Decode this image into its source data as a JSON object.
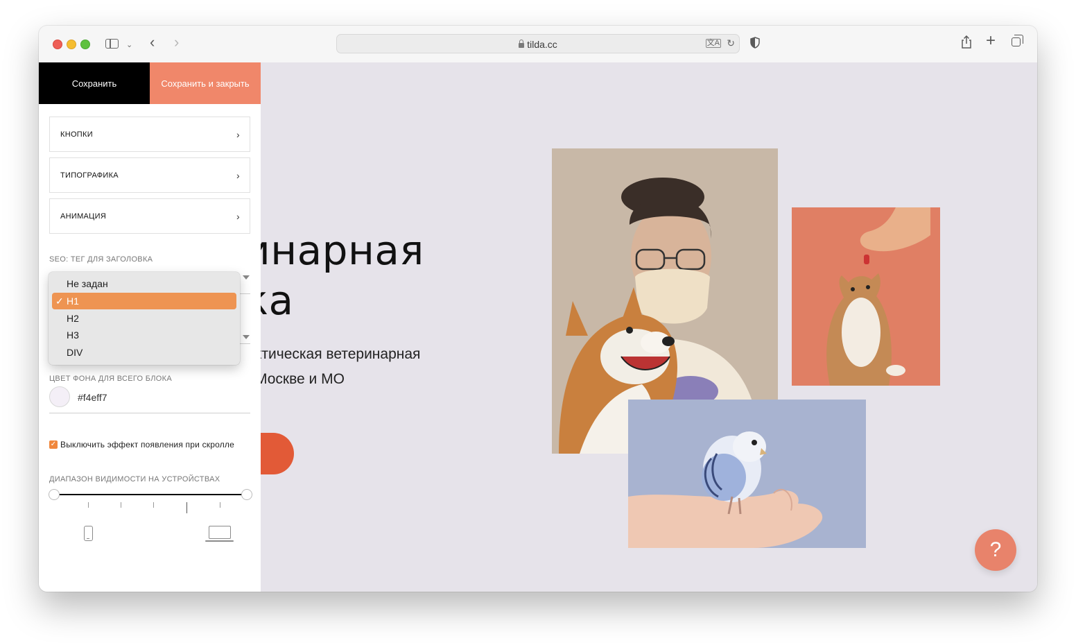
{
  "browser": {
    "url": "tilda.cc"
  },
  "editor": {
    "save_label": "Сохранить",
    "save_close_label": "Сохранить и закрыть",
    "sections": [
      {
        "label": "КНОПКИ"
      },
      {
        "label": "ТИПОГРАФИКА"
      },
      {
        "label": "АНИМАЦИЯ"
      }
    ],
    "seo_label": "SEO: ТЕГ ДЛЯ ЗАГОЛОВКА",
    "seo_options": [
      "Не задан",
      "H1",
      "H2",
      "H3",
      "DIV"
    ],
    "seo_selected": "H1",
    "bg_color_label": "ЦВЕТ ФОНА ДЛЯ ВСЕГО БЛОКА",
    "bg_color_value": "#f4eff7",
    "disable_scroll_label": "Выключить эффект появления при скролле",
    "disable_scroll_checked": true,
    "visibility_label": "ДИАПАЗОН ВИДИМОСТИ НА УСТРОЙСТВАХ"
  },
  "preview": {
    "title": "инарная\nка",
    "subtitle": "ктическая ветеринарная\nМоскве и МО",
    "help_label": "?"
  },
  "colors": {
    "accent": "#f0876a",
    "selected": "#ee9452",
    "button": "#e25a37",
    "page_bg": "#e6e3ea"
  }
}
